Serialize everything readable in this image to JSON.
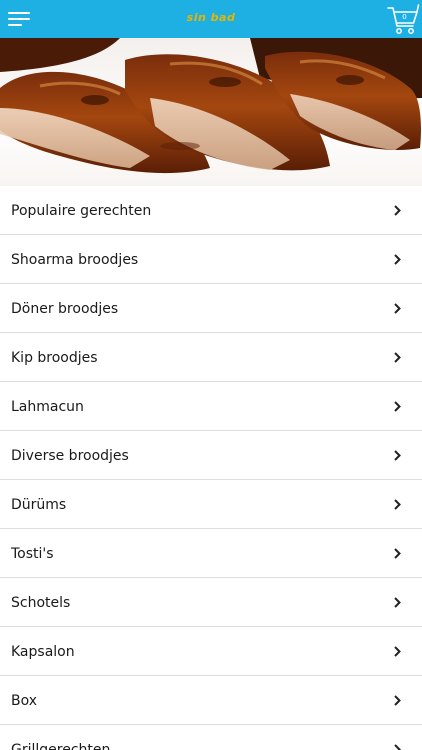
{
  "header": {
    "logo_text": "sin bad",
    "menu_icon": "hamburger-menu-icon",
    "cart_icon": "shopping-cart-icon",
    "cart_count": "0",
    "background_color": "#1fb0e3",
    "logo_color": "#e8b400"
  },
  "hero": {
    "image_subject": "glazed barbecue spare ribs"
  },
  "categories": [
    {
      "label": "Populaire gerechten"
    },
    {
      "label": "Shoarma broodjes"
    },
    {
      "label": "Döner broodjes"
    },
    {
      "label": "Kip broodjes"
    },
    {
      "label": "Lahmacun"
    },
    {
      "label": "Diverse broodjes"
    },
    {
      "label": "Dürüms"
    },
    {
      "label": "Tosti's"
    },
    {
      "label": "Schotels"
    },
    {
      "label": "Kapsalon"
    },
    {
      "label": "Box"
    },
    {
      "label": "Grillgerechten"
    }
  ],
  "list_icon": "chevron-right-icon"
}
